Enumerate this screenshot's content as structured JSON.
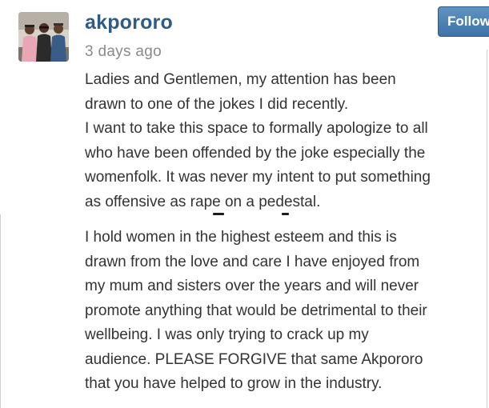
{
  "post": {
    "username": "akpororo",
    "timestamp": "3 days ago",
    "follow_label": "Follow",
    "caption_part1": [
      "Ladies and Gentlemen, my attention has been",
      "drawn to one of the jokes I did recently.",
      "I want to take this space to formally apologize to all",
      "who have been offended by the joke especially the",
      "womenfolk. It was never my intent to put something",
      "as offensive as rape on a pedestal."
    ],
    "caption_part2": [
      "I hold women in the highest esteem and this is",
      "drawn from the love and care I have enjoyed from",
      "my mum and sisters over the years and will never",
      "promote anything that would be detrimental to their",
      "wellbeing. I was only trying to crack up my",
      "audience. PLEASE FORGIVE that same Akpororo",
      "that you have helped to grow in the industry."
    ]
  },
  "colors": {
    "username": "#2f5b85",
    "timestamp": "#8a8a8a",
    "body_text": "#333333",
    "follow_button": "#4a80b3"
  }
}
